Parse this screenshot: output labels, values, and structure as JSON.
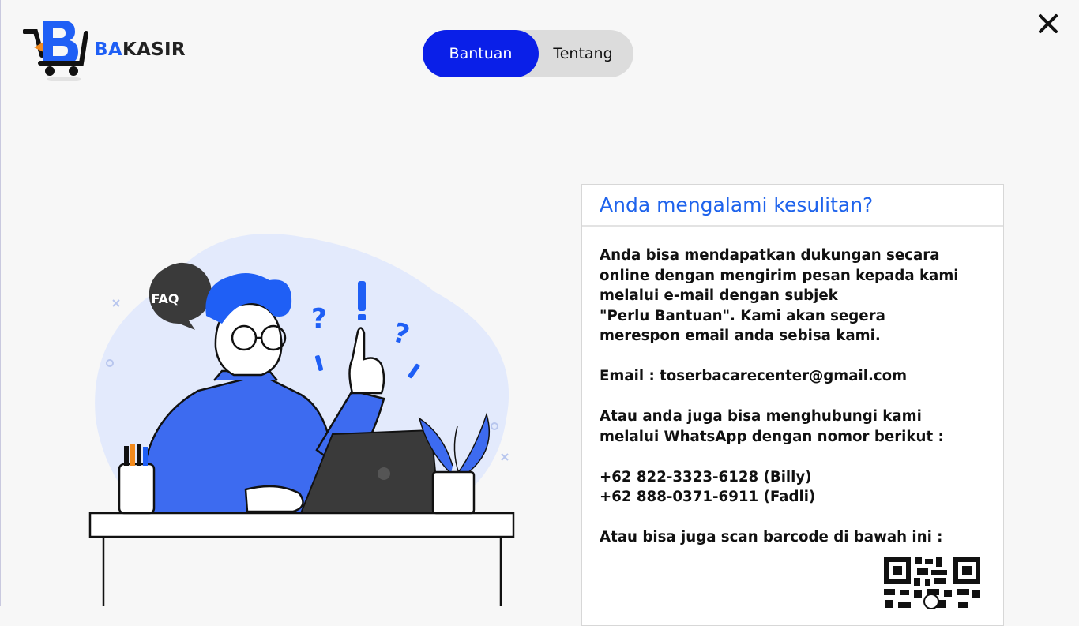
{
  "app": {
    "logo_text_prefix": "BA",
    "logo_text_suffix": "KASIR"
  },
  "tabs": [
    {
      "label": "Bantuan",
      "active": true
    },
    {
      "label": "Tentang",
      "active": false
    }
  ],
  "illustration": {
    "faq_label": "FAQ"
  },
  "card": {
    "title": "Anda mengalami kesulitan?",
    "intro": "Anda bisa mendapatkan dukungan secara\nonline dengan mengirim pesan kepada kami\nmelalui e-mail dengan subjek\n\"Perlu Bantuan\". Kami akan segera\nmerespon email anda sebisa kami.",
    "email": "Email : toserbacarecenter@gmail.com",
    "whatsapp_intro": "Atau anda juga bisa menghubungi kami\nmelalui WhatsApp dengan nomor berikut :",
    "phones": "+62 822-3323-6128 (Billy)\n+62 888-0371-6911 (Fadli)",
    "barcode_intro": "Atau bisa juga scan barcode di bawah ini :"
  },
  "colors": {
    "accent": "#1f5ff5",
    "tab_active": "#0a1fe8",
    "title_blue": "#1e63ec",
    "blob": "#e3eafc",
    "sweater": "#3d6bf0"
  },
  "icons": {
    "close": "close-icon",
    "qr": "qr-code-icon"
  }
}
